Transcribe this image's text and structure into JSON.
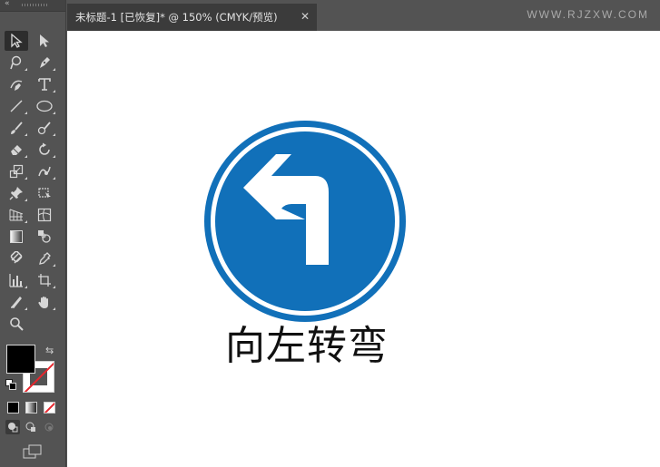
{
  "window": {
    "watermark": "WWW.RJZXW.COM"
  },
  "tools_panel": {
    "collapse_glyph": "«",
    "tools": [
      {
        "name": "selection-tool",
        "icon": "selection-arrow-icon",
        "selected": true
      },
      {
        "name": "direct-selection-tool",
        "icon": "direct-selection-arrow-icon",
        "selected": false
      },
      {
        "name": "magic-wand-tool",
        "icon": "magic-wand-icon",
        "selected": false
      },
      {
        "name": "pen-tool",
        "icon": "pen-icon",
        "selected": false
      },
      {
        "name": "curvature-tool",
        "icon": "curvature-pen-icon",
        "selected": false
      },
      {
        "name": "type-tool",
        "icon": "type-icon",
        "glyph": "T",
        "selected": false
      },
      {
        "name": "line-tool",
        "icon": "line-segment-icon",
        "selected": false
      },
      {
        "name": "ellipse-tool",
        "icon": "ellipse-icon",
        "selected": false
      },
      {
        "name": "paintbrush-tool",
        "icon": "paintbrush-icon",
        "selected": false
      },
      {
        "name": "blob-brush-tool",
        "icon": "blob-brush-icon",
        "selected": false
      },
      {
        "name": "eraser-tool",
        "icon": "eraser-icon",
        "selected": false
      },
      {
        "name": "rotate-tool",
        "icon": "rotate-icon",
        "selected": false
      },
      {
        "name": "scale-tool",
        "icon": "scale-icon",
        "selected": false
      },
      {
        "name": "warp-tool",
        "icon": "warp-icon",
        "selected": false
      },
      {
        "name": "puppet-warp-tool",
        "icon": "pushpin-icon",
        "selected": false
      },
      {
        "name": "free-transform-tool",
        "icon": "free-transform-icon",
        "selected": false
      },
      {
        "name": "perspective-grid-tool",
        "icon": "perspective-grid-icon",
        "selected": false
      },
      {
        "name": "mesh-tool",
        "icon": "mesh-icon",
        "selected": false
      },
      {
        "name": "gradient-tool",
        "icon": "gradient-icon",
        "selected": false
      },
      {
        "name": "blend-tool",
        "icon": "blend-icon",
        "selected": false
      },
      {
        "name": "shape-builder-tool",
        "icon": "shape-builder-icon",
        "selected": false
      },
      {
        "name": "eyedropper-tool",
        "icon": "eyedropper-icon",
        "selected": false
      },
      {
        "name": "column-graph-tool",
        "icon": "bar-graph-icon",
        "selected": false
      },
      {
        "name": "artboard-tool",
        "icon": "artboard-icon",
        "selected": false
      },
      {
        "name": "slice-tool",
        "icon": "slice-knife-icon",
        "selected": false
      },
      {
        "name": "hand-tool",
        "icon": "hand-icon",
        "selected": false
      },
      {
        "name": "zoom-tool",
        "icon": "magnifier-icon",
        "selected": false
      }
    ],
    "swap_glyph": "⇆",
    "colors": {
      "fill": "#000000",
      "stroke": "none"
    }
  },
  "document_tab": {
    "title": "未标题-1 [已恢复]* @ 150% (CMYK/预览)",
    "close_glyph": "✕"
  },
  "artwork": {
    "caption": "向左转弯",
    "colors": {
      "sign_blue": "#1170B9",
      "ring_white": "#ffffff",
      "arrow_white": "#ffffff",
      "caption": "#111111"
    }
  }
}
